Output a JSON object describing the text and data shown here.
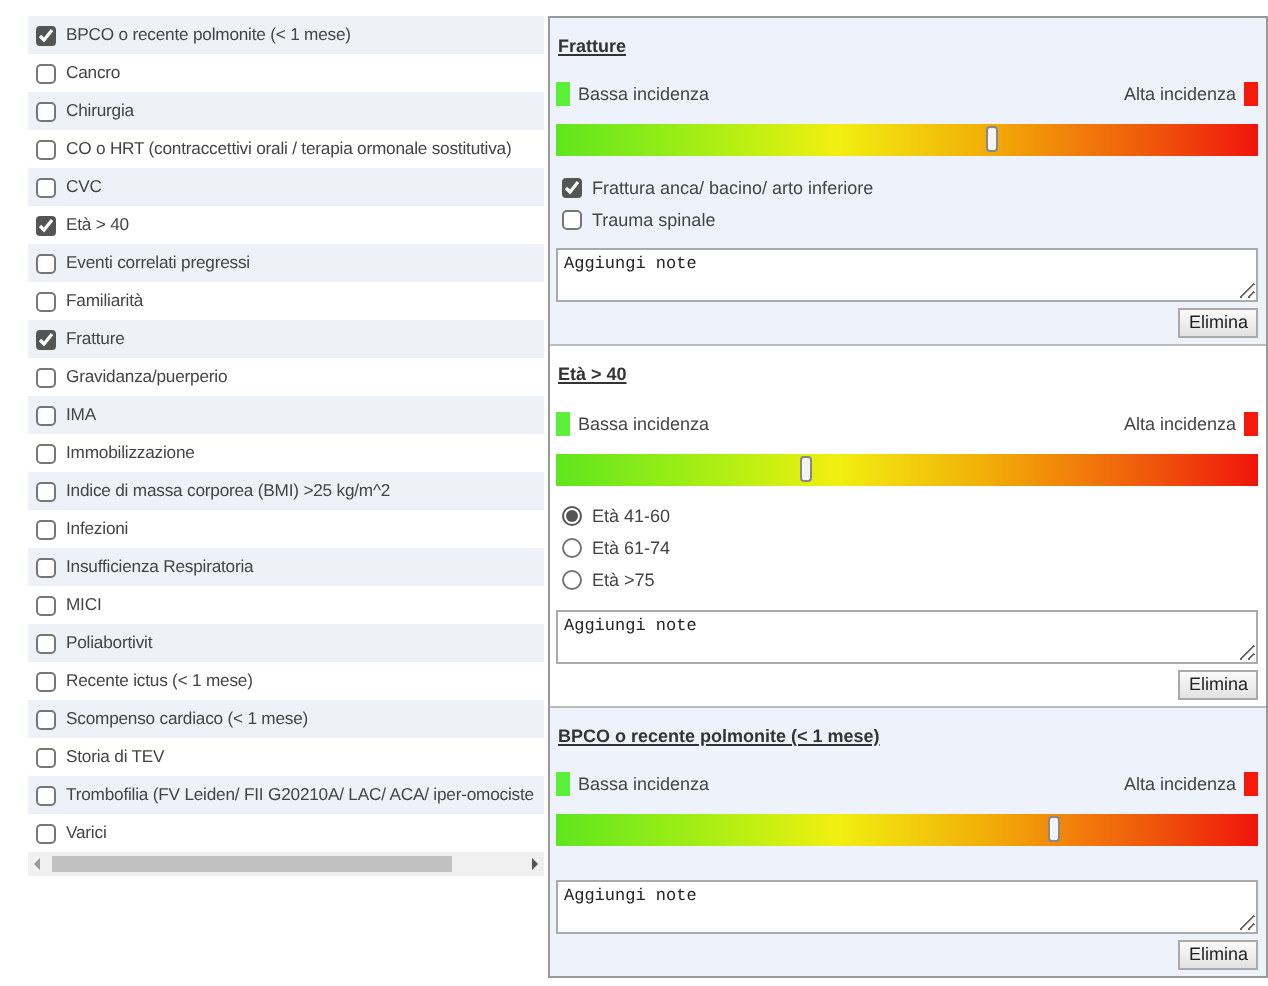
{
  "factors": [
    {
      "label": "BPCO o recente polmonite (< 1 mese)",
      "checked": true
    },
    {
      "label": "Cancro",
      "checked": false
    },
    {
      "label": "Chirurgia",
      "checked": false
    },
    {
      "label": "CO o HRT (contraccettivi orali / terapia ormonale sostitutiva)",
      "checked": false
    },
    {
      "label": "CVC",
      "checked": false
    },
    {
      "label": "Età > 40",
      "checked": true
    },
    {
      "label": "Eventi correlati pregressi",
      "checked": false
    },
    {
      "label": "Familiarità",
      "checked": false
    },
    {
      "label": "Fratture",
      "checked": true
    },
    {
      "label": "Gravidanza/puerperio",
      "checked": false
    },
    {
      "label": "IMA",
      "checked": false
    },
    {
      "label": "Immobilizzazione",
      "checked": false
    },
    {
      "label": "Indice di massa corporea (BMI) >25 kg/m^2",
      "checked": false
    },
    {
      "label": "Infezioni",
      "checked": false
    },
    {
      "label": "Insufficienza Respiratoria",
      "checked": false
    },
    {
      "label": "MICI",
      "checked": false
    },
    {
      "label": "Poliabortivit",
      "checked": false
    },
    {
      "label": "Recente ictus (< 1 mese)",
      "checked": false
    },
    {
      "label": "Scompenso cardiaco (< 1 mese)",
      "checked": false
    },
    {
      "label": "Storia di TEV",
      "checked": false
    },
    {
      "label": "Trombofilia (FV Leiden/ FII G20210A/ LAC/ ACA/ iper-omociste",
      "checked": false
    },
    {
      "label": "Varici",
      "checked": false
    }
  ],
  "details": [
    {
      "title": "Fratture",
      "low_label": "Bassa incidenza",
      "high_label": "Alta incidenza",
      "level": 0.62,
      "kind": "checkboxes",
      "options": [
        {
          "label": "Frattura anca/ bacino/ arto inferiore",
          "checked": true
        },
        {
          "label": "Trauma spinale",
          "checked": false
        }
      ],
      "note": "Aggiungi note",
      "button": "Elimina"
    },
    {
      "title": "Età > 40",
      "low_label": "Bassa incidenza",
      "high_label": "Alta incidenza",
      "level": 0.355,
      "kind": "radios",
      "options": [
        {
          "label": "Età 41-60",
          "selected": true
        },
        {
          "label": "Età  61-74",
          "selected": false
        },
        {
          "label": "Età >75",
          "selected": false
        }
      ],
      "note": "Aggiungi note",
      "button": "Elimina"
    },
    {
      "title": "BPCO o recente polmonite (< 1 mese)",
      "low_label": "Bassa incidenza",
      "high_label": "Alta incidenza",
      "level": 0.71,
      "kind": "plain",
      "note": "Aggiungi note",
      "button": "Elimina"
    }
  ]
}
